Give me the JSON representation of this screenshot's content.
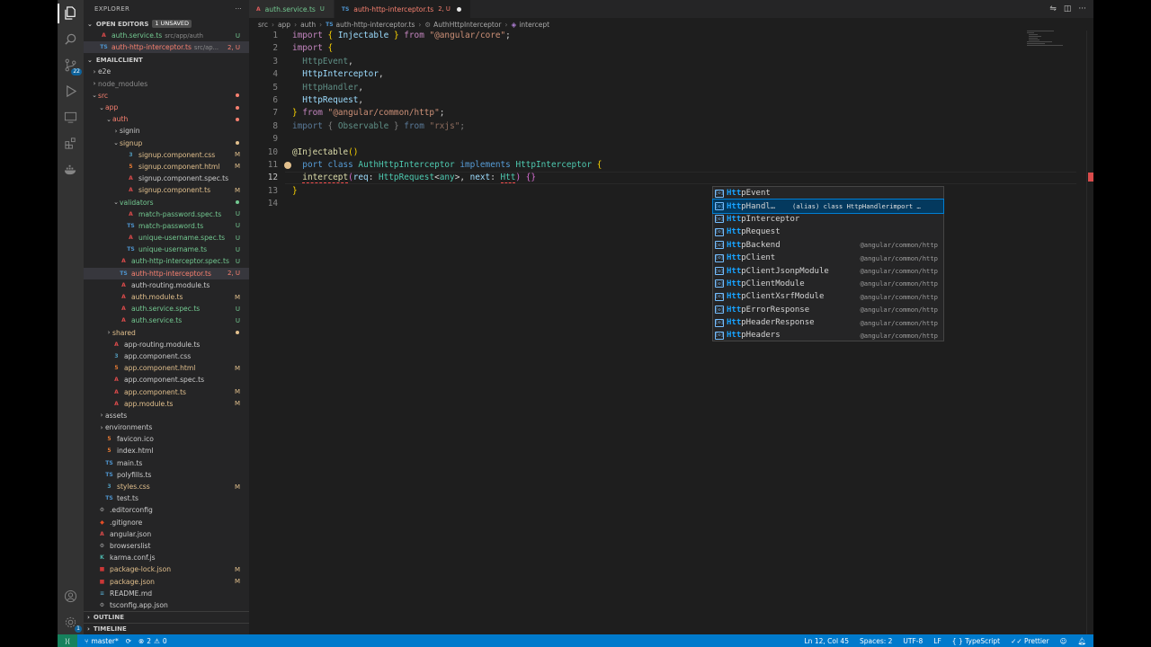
{
  "explorer": {
    "title": "EXPLORER",
    "more": "···",
    "open_editors_label": "OPEN EDITORS",
    "unsaved_badge": "1 UNSAVED",
    "open_editors": [
      {
        "name": "auth.service.ts",
        "path": "src/app/auth",
        "status": "U",
        "type": "angular"
      },
      {
        "name": "auth-http-interceptor.ts",
        "path": "src/ap...",
        "status": "2, U",
        "type": "ts"
      }
    ],
    "workspace_label": "EMAILCLIENT",
    "tree": [
      {
        "name": "e2e",
        "depth": 0,
        "kind": "folder",
        "open": false,
        "color": "def"
      },
      {
        "name": "node_modules",
        "depth": 0,
        "kind": "folder",
        "open": false,
        "color": "ign"
      },
      {
        "name": "src",
        "depth": 0,
        "kind": "folder",
        "open": true,
        "color": "err",
        "dot": true
      },
      {
        "name": "app",
        "depth": 1,
        "kind": "folder",
        "open": true,
        "color": "err",
        "dot": true
      },
      {
        "name": "auth",
        "depth": 2,
        "kind": "folder",
        "open": true,
        "color": "err",
        "dot": true
      },
      {
        "name": "signin",
        "depth": 3,
        "kind": "folder",
        "open": false,
        "color": "def"
      },
      {
        "name": "signup",
        "depth": 3,
        "kind": "folder",
        "open": true,
        "color": "mod",
        "dot": true
      },
      {
        "name": "signup.component.css",
        "depth": 4,
        "kind": "css",
        "color": "mod",
        "status": "M"
      },
      {
        "name": "signup.component.html",
        "depth": 4,
        "kind": "html",
        "color": "mod",
        "status": "M"
      },
      {
        "name": "signup.component.spec.ts",
        "depth": 4,
        "kind": "angular",
        "color": "def"
      },
      {
        "name": "signup.component.ts",
        "depth": 4,
        "kind": "angular",
        "color": "mod",
        "status": "M"
      },
      {
        "name": "validators",
        "depth": 3,
        "kind": "folder",
        "open": true,
        "color": "unt",
        "dot": true
      },
      {
        "name": "match-password.spec.ts",
        "depth": 4,
        "kind": "angular",
        "color": "unt",
        "status": "U"
      },
      {
        "name": "match-password.ts",
        "depth": 4,
        "kind": "ts",
        "color": "unt",
        "status": "U"
      },
      {
        "name": "unique-username.spec.ts",
        "depth": 4,
        "kind": "angular",
        "color": "unt",
        "status": "U"
      },
      {
        "name": "unique-username.ts",
        "depth": 4,
        "kind": "ts",
        "color": "unt",
        "status": "U"
      },
      {
        "name": "auth-http-interceptor.spec.ts",
        "depth": 3,
        "kind": "angular",
        "color": "unt",
        "status": "U"
      },
      {
        "name": "auth-http-interceptor.ts",
        "depth": 3,
        "kind": "ts",
        "color": "err",
        "status": "2, U",
        "selected": true
      },
      {
        "name": "auth-routing.module.ts",
        "depth": 3,
        "kind": "angular",
        "color": "def"
      },
      {
        "name": "auth.module.ts",
        "depth": 3,
        "kind": "angular",
        "color": "mod",
        "status": "M"
      },
      {
        "name": "auth.service.spec.ts",
        "depth": 3,
        "kind": "angular",
        "color": "unt",
        "status": "U"
      },
      {
        "name": "auth.service.ts",
        "depth": 3,
        "kind": "angular",
        "color": "unt",
        "status": "U"
      },
      {
        "name": "shared",
        "depth": 2,
        "kind": "folder",
        "open": false,
        "color": "mod",
        "dot": true
      },
      {
        "name": "app-routing.module.ts",
        "depth": 2,
        "kind": "angular",
        "color": "def"
      },
      {
        "name": "app.component.css",
        "depth": 2,
        "kind": "css",
        "color": "def"
      },
      {
        "name": "app.component.html",
        "depth": 2,
        "kind": "html",
        "color": "mod",
        "status": "M"
      },
      {
        "name": "app.component.spec.ts",
        "depth": 2,
        "kind": "angular",
        "color": "def"
      },
      {
        "name": "app.component.ts",
        "depth": 2,
        "kind": "angular",
        "color": "mod",
        "status": "M"
      },
      {
        "name": "app.module.ts",
        "depth": 2,
        "kind": "angular",
        "color": "mod",
        "status": "M"
      },
      {
        "name": "assets",
        "depth": 1,
        "kind": "folder",
        "open": false,
        "color": "def"
      },
      {
        "name": "environments",
        "depth": 1,
        "kind": "folder",
        "open": false,
        "color": "def"
      },
      {
        "name": "favicon.ico",
        "depth": 1,
        "kind": "html",
        "color": "def"
      },
      {
        "name": "index.html",
        "depth": 1,
        "kind": "html",
        "color": "def"
      },
      {
        "name": "main.ts",
        "depth": 1,
        "kind": "ts",
        "color": "def"
      },
      {
        "name": "polyfills.ts",
        "depth": 1,
        "kind": "ts",
        "color": "def"
      },
      {
        "name": "styles.css",
        "depth": 1,
        "kind": "css",
        "color": "mod",
        "status": "M"
      },
      {
        "name": "test.ts",
        "depth": 1,
        "kind": "ts",
        "color": "def"
      },
      {
        "name": ".editorconfig",
        "depth": 0,
        "kind": "config",
        "color": "def"
      },
      {
        "name": ".gitignore",
        "depth": 0,
        "kind": "git",
        "color": "def"
      },
      {
        "name": "angular.json",
        "depth": 0,
        "kind": "angular",
        "color": "def"
      },
      {
        "name": "browserslist",
        "depth": 0,
        "kind": "config",
        "color": "def"
      },
      {
        "name": "karma.conf.js",
        "depth": 0,
        "kind": "karma",
        "color": "def"
      },
      {
        "name": "package-lock.json",
        "depth": 0,
        "kind": "npm",
        "color": "mod",
        "status": "M"
      },
      {
        "name": "package.json",
        "depth": 0,
        "kind": "npm",
        "color": "mod",
        "status": "M"
      },
      {
        "name": "README.md",
        "depth": 0,
        "kind": "md",
        "color": "def"
      },
      {
        "name": "tsconfig.app.json",
        "depth": 0,
        "kind": "config",
        "color": "def"
      }
    ],
    "outline_label": "OUTLINE",
    "timeline_label": "TIMELINE"
  },
  "activity": {
    "items": [
      "explorer-icon",
      "search-icon",
      "source-control-icon",
      "run-debug-icon",
      "remote-explorer-icon",
      "extensions-icon",
      "docker-icon"
    ],
    "scm_badge": "22",
    "bottom": [
      "account-icon",
      "settings-gear-icon"
    ],
    "settings_badge": "1"
  },
  "tabs": [
    {
      "label": "auth.service.ts",
      "suffix": "U",
      "icon": "A",
      "active": false
    },
    {
      "label": "auth-http-interceptor.ts",
      "suffix": "2, U",
      "icon": "TS",
      "active": true,
      "dirty": true
    }
  ],
  "breadcrumb": [
    "src",
    "app",
    "auth",
    "auth-http-interceptor.ts",
    "AuthHttpInterceptor",
    "intercept"
  ],
  "code_lines": [
    "1",
    "2",
    "3",
    "4",
    "5",
    "6",
    "7",
    "8",
    "9",
    "10",
    "11",
    "12",
    "13",
    "14"
  ],
  "suggest": {
    "typed": "Htt",
    "items": [
      {
        "rest": "pEvent",
        "detail": ""
      },
      {
        "rest": "pHandl…",
        "detail": "(alias) class HttpHandlerimport …",
        "selected": true
      },
      {
        "rest": "pInterceptor",
        "detail": ""
      },
      {
        "rest": "pRequest",
        "detail": ""
      },
      {
        "rest": "pBackend",
        "detail": "@angular/common/http"
      },
      {
        "rest": "pClient",
        "detail": "@angular/common/http"
      },
      {
        "rest": "pClientJsonpModule",
        "detail": "@angular/common/http"
      },
      {
        "rest": "pClientModule",
        "detail": "@angular/common/http"
      },
      {
        "rest": "pClientXsrfModule",
        "detail": "@angular/common/http"
      },
      {
        "rest": "pErrorResponse",
        "detail": "@angular/common/http"
      },
      {
        "rest": "pHeaderResponse",
        "detail": "@angular/common/http"
      },
      {
        "rest": "pHeaders",
        "detail": "@angular/common/http"
      }
    ]
  },
  "status_bar": {
    "branch": "master*",
    "errors": "2",
    "warnings": "0",
    "cursor": "Ln 12, Col 45",
    "spaces": "Spaces: 2",
    "encoding": "UTF-8",
    "eol": "LF",
    "language": "TypeScript",
    "formatter": "Prettier"
  },
  "colors": {
    "accent": "#007acc",
    "modified": "#e2c08d",
    "untracked": "#73c991",
    "error": "#f88070"
  }
}
